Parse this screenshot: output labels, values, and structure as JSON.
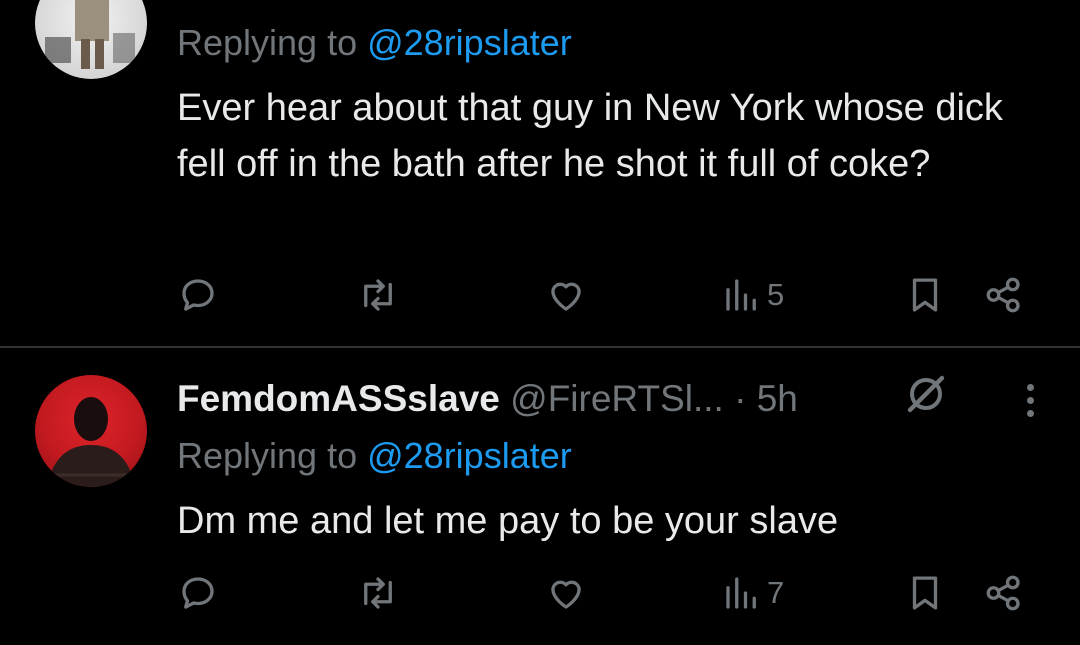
{
  "tweets": [
    {
      "reply_prefix": "Replying to ",
      "mention": "@28ripslater",
      "text": "Ever hear about that guy in New York whose dick fell off in the bath after he shot it full of coke?",
      "views": "5"
    },
    {
      "name": "FemdomASSslave",
      "handle": "@FireRTSl...",
      "dot": " · ",
      "time": "5h",
      "reply_prefix": "Replying to ",
      "mention": "@28ripslater",
      "text": "Dm me and let me pay to be your slave",
      "views": "7"
    }
  ],
  "icons": {
    "reply": "reply-icon",
    "retweet": "retweet-icon",
    "like": "heart-icon",
    "views": "views-icon",
    "bookmark": "bookmark-icon",
    "share": "share-icon",
    "more": "more-options-icon",
    "grok": "grok-icon"
  },
  "colors": {
    "background": "#000000",
    "text": "#e7e9ea",
    "muted": "#71767b",
    "accent": "#1d9bf0",
    "divider": "#2f3336"
  }
}
